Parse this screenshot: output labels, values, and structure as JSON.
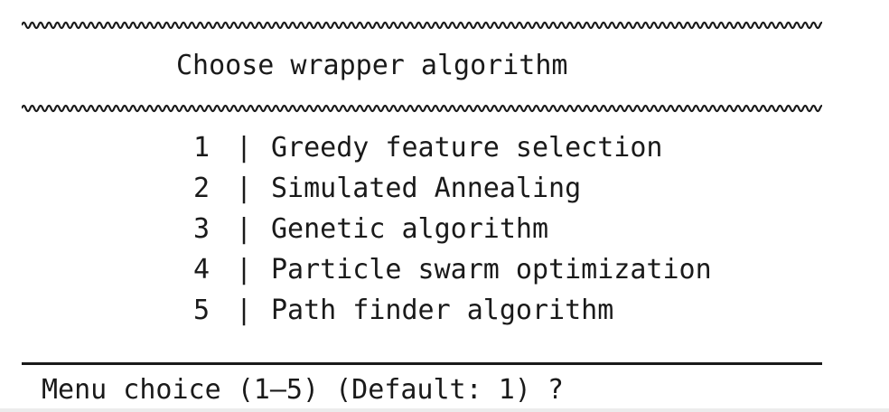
{
  "header": {
    "title": "Choose wrapper algorithm"
  },
  "menu": {
    "items": [
      {
        "number": "1",
        "separator": "|",
        "label": "Greedy feature selection"
      },
      {
        "number": "2",
        "separator": "|",
        "label": "Simulated Annealing"
      },
      {
        "number": "3",
        "separator": "|",
        "label": "Genetic algorithm"
      },
      {
        "number": "4",
        "separator": "|",
        "label": "Particle swarm optimization"
      },
      {
        "number": "5",
        "separator": "|",
        "label": "Path finder algorithm"
      }
    ]
  },
  "prompt": {
    "text": "Menu choice (1–5) (Default: 1) ?"
  }
}
